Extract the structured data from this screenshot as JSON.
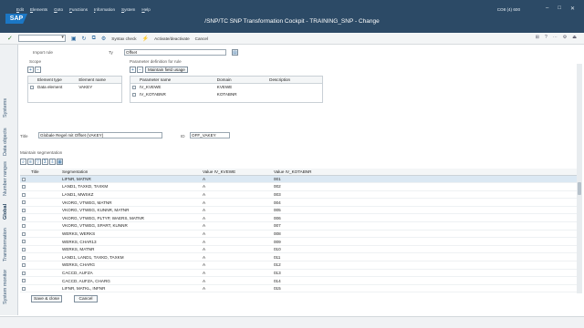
{
  "menu": [
    "Edit",
    "Elements",
    "Goto",
    "Functions",
    "Information",
    "System",
    "Help"
  ],
  "window_title": "/SNP/TC SNP Transformation Cockpit - TRAINING_SNP - Change",
  "system_info": "CO8 (4) 600",
  "toolbar": {
    "syntax_check": "Syntax check",
    "activate": "Activate/deactivate",
    "cancel": "Cancel"
  },
  "nav_tabs": [
    "Systems",
    "Data objects",
    "Number ranges",
    "Global",
    "Transformation",
    "System monitor"
  ],
  "import_rule": {
    "label": "Import rule",
    "scope_label": "Scope",
    "type_label": "Ty",
    "type_value": "Offset",
    "param_def_label": "Parameter definition for rule",
    "maintain_btn": "Maintain field usage"
  },
  "scope_table": {
    "headers": [
      "Element type",
      "Element name"
    ],
    "rows": [
      [
        "Data element",
        "VAKEY"
      ]
    ]
  },
  "param_table": {
    "headers": [
      "Parameter name",
      "Domain",
      "Description"
    ],
    "rows": [
      [
        "IV_KVEWE",
        "KVEWE",
        ""
      ],
      [
        "IV_KOTABNR",
        "KOTABNR",
        ""
      ]
    ]
  },
  "title_field": {
    "label": "Title",
    "value": "Globale Regel mit Offset (VAKEY)",
    "id_label": "ID",
    "id_value": "OFF_VAKEY"
  },
  "segmentation": {
    "label": "Maintain segmentation",
    "headers": [
      "Title",
      "Segmentation",
      "Value IV_KVEWE",
      "Value IV_KOTABNR"
    ],
    "rows": [
      [
        "",
        "LIFNR, MATNR",
        "A",
        "001"
      ],
      [
        "",
        "LAND1, TAXKD, TAXKM",
        "A",
        "002"
      ],
      [
        "",
        "LAND1, MWSKZ",
        "A",
        "003"
      ],
      [
        "",
        "VKORG, VTWEG, MATNR",
        "A",
        "004"
      ],
      [
        "",
        "VKORG, VTWEG, KUNNR, MATNR",
        "A",
        "005"
      ],
      [
        "",
        "VKORG, VTWEG, PLTYP, WAERS, MATNR",
        "A",
        "006"
      ],
      [
        "",
        "VKORG, VTWEG, SPART, KUNNR",
        "A",
        "007"
      ],
      [
        "",
        "WERKS, WERKS",
        "A",
        "008"
      ],
      [
        "",
        "WERKS, CHAR13",
        "A",
        "009"
      ],
      [
        "",
        "WERKS, MATNR",
        "A",
        "010"
      ],
      [
        "",
        "LAND1, LAND1, TAXKD, TAXKM",
        "A",
        "011"
      ],
      [
        "",
        "WERKS, CHARG",
        "A",
        "012"
      ],
      [
        "",
        "CACCD, AUFZA",
        "A",
        "013"
      ],
      [
        "",
        "CACCD, AUFZA, CHARG",
        "A",
        "014"
      ],
      [
        "",
        "LIFNR, MATKL, INFNR",
        "A",
        "015"
      ]
    ]
  },
  "footer": {
    "save_close": "Save & close",
    "cancel": "Cancel"
  }
}
